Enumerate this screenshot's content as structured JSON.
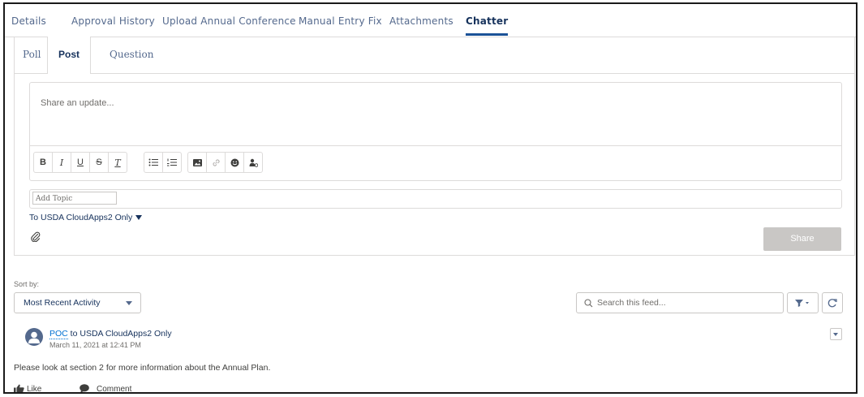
{
  "top_tabs": [
    "Details",
    "Approval History",
    "Upload Annual Conference",
    "Manual Entry Fix",
    "Attachments",
    "Chatter"
  ],
  "active_top_tab": "Chatter",
  "publisher": {
    "tabs": [
      "Poll",
      "Post",
      "Question"
    ],
    "active_tab": "Post",
    "placeholder": "Share an update...",
    "toolbar": {
      "bold": "B",
      "italic": "I",
      "underline": "U",
      "strikethrough": "S",
      "clear_format": "T"
    },
    "add_topic_placeholder": "Add Topic",
    "to_label": "To  USDA CloudApps2 Only",
    "share_label": "Share"
  },
  "feed": {
    "sort_label": "Sort by:",
    "sort_value": "Most Recent Activity",
    "search_placeholder": "Search this feed...",
    "posts": [
      {
        "author": "POC",
        "audience": " to USDA CloudApps2 Only",
        "timestamp": "March 11, 2021 at 12:41 PM",
        "body": "Please look at section 2 for more information about the Annual Plan.",
        "like_label": "Like",
        "comment_label": "Comment"
      }
    ]
  },
  "colors": {
    "accent": "#1b5297",
    "link": "#0070d2",
    "share_disabled": "#c9c7c5",
    "avatar": "#54698d"
  }
}
